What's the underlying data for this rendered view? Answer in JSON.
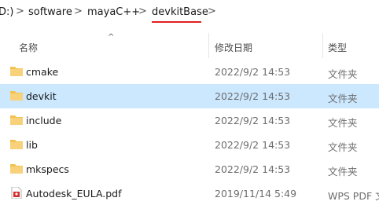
{
  "breadcrumb": {
    "items": [
      {
        "label": "D:)"
      },
      {
        "label": "software"
      },
      {
        "label": "mayaC++"
      },
      {
        "label": "devkitBase"
      }
    ],
    "separator": ">"
  },
  "columns": {
    "name": "名称",
    "date_modified": "修改日期",
    "type": "类型"
  },
  "files": [
    {
      "name": "cmake",
      "date": "2022/9/2 14:53",
      "type": "文件夹",
      "icon": "folder-icon"
    },
    {
      "name": "devkit",
      "date": "2022/9/2 14:53",
      "type": "文件夹",
      "icon": "folder-icon",
      "selected": true
    },
    {
      "name": "include",
      "date": "2022/9/2 14:53",
      "type": "文件夹",
      "icon": "folder-icon"
    },
    {
      "name": "lib",
      "date": "2022/9/2 14:53",
      "type": "文件夹",
      "icon": "folder-icon"
    },
    {
      "name": "mkspecs",
      "date": "2022/9/2 14:53",
      "type": "文件夹",
      "icon": "folder-icon"
    },
    {
      "name": "Autodesk_EULA.pdf",
      "date": "2019/11/14 5:49",
      "type": "WPS PDF 文",
      "icon": "pdf-file-icon"
    }
  ],
  "colors": {
    "folder": "#f2c24e",
    "folder_dark": "#dba73a",
    "selection": "#cce8ff",
    "pdf": "#d32f2f",
    "underline": "#e02020"
  }
}
